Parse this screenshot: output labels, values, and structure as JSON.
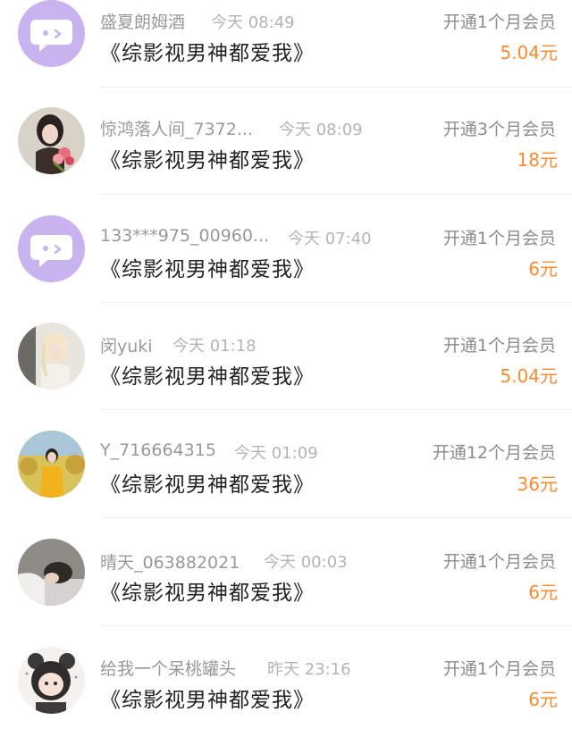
{
  "rows": [
    {
      "avatar_icon": "chat-bubble-icon",
      "name": "盛夏朗姆酒",
      "time": "今天 08:49",
      "title": "《综影视男神都爱我》",
      "plan": "开通1个月会员",
      "price": "5.04元"
    },
    {
      "avatar_icon": "user-photo-icon",
      "name": "惊鸿落人间_7372...",
      "time": "今天 08:09",
      "title": "《综影视男神都爱我》",
      "plan": "开通3个月会员",
      "price": "18元"
    },
    {
      "avatar_icon": "chat-bubble-icon",
      "name": "133***975_00960...",
      "time": "今天 07:40",
      "title": "《综影视男神都爱我》",
      "plan": "开通1个月会员",
      "price": "6元"
    },
    {
      "avatar_icon": "user-photo-icon",
      "name": "闵yuki",
      "time": "今天 01:18",
      "title": "《综影视男神都爱我》",
      "plan": "开通1个月会员",
      "price": "5.04元"
    },
    {
      "avatar_icon": "user-photo-icon",
      "name": "Y_716664315",
      "time": "今天 01:09",
      "title": "《综影视男神都爱我》",
      "plan": "开通12个月会员",
      "price": "36元"
    },
    {
      "avatar_icon": "user-photo-icon",
      "name": "晴天_063882021",
      "time": "今天 00:03",
      "title": "《综影视男神都爱我》",
      "plan": "开通1个月会员",
      "price": "6元"
    },
    {
      "avatar_icon": "user-photo-icon",
      "name": "给我一个呆桃罐头",
      "time": "昨天 23:16",
      "title": "《综影视男神都爱我》",
      "plan": "开通1个月会员",
      "price": "6元"
    }
  ],
  "colors": {
    "accent_price": "#ff8a2b",
    "chat_avatar_bg": "#c9b3ef"
  }
}
